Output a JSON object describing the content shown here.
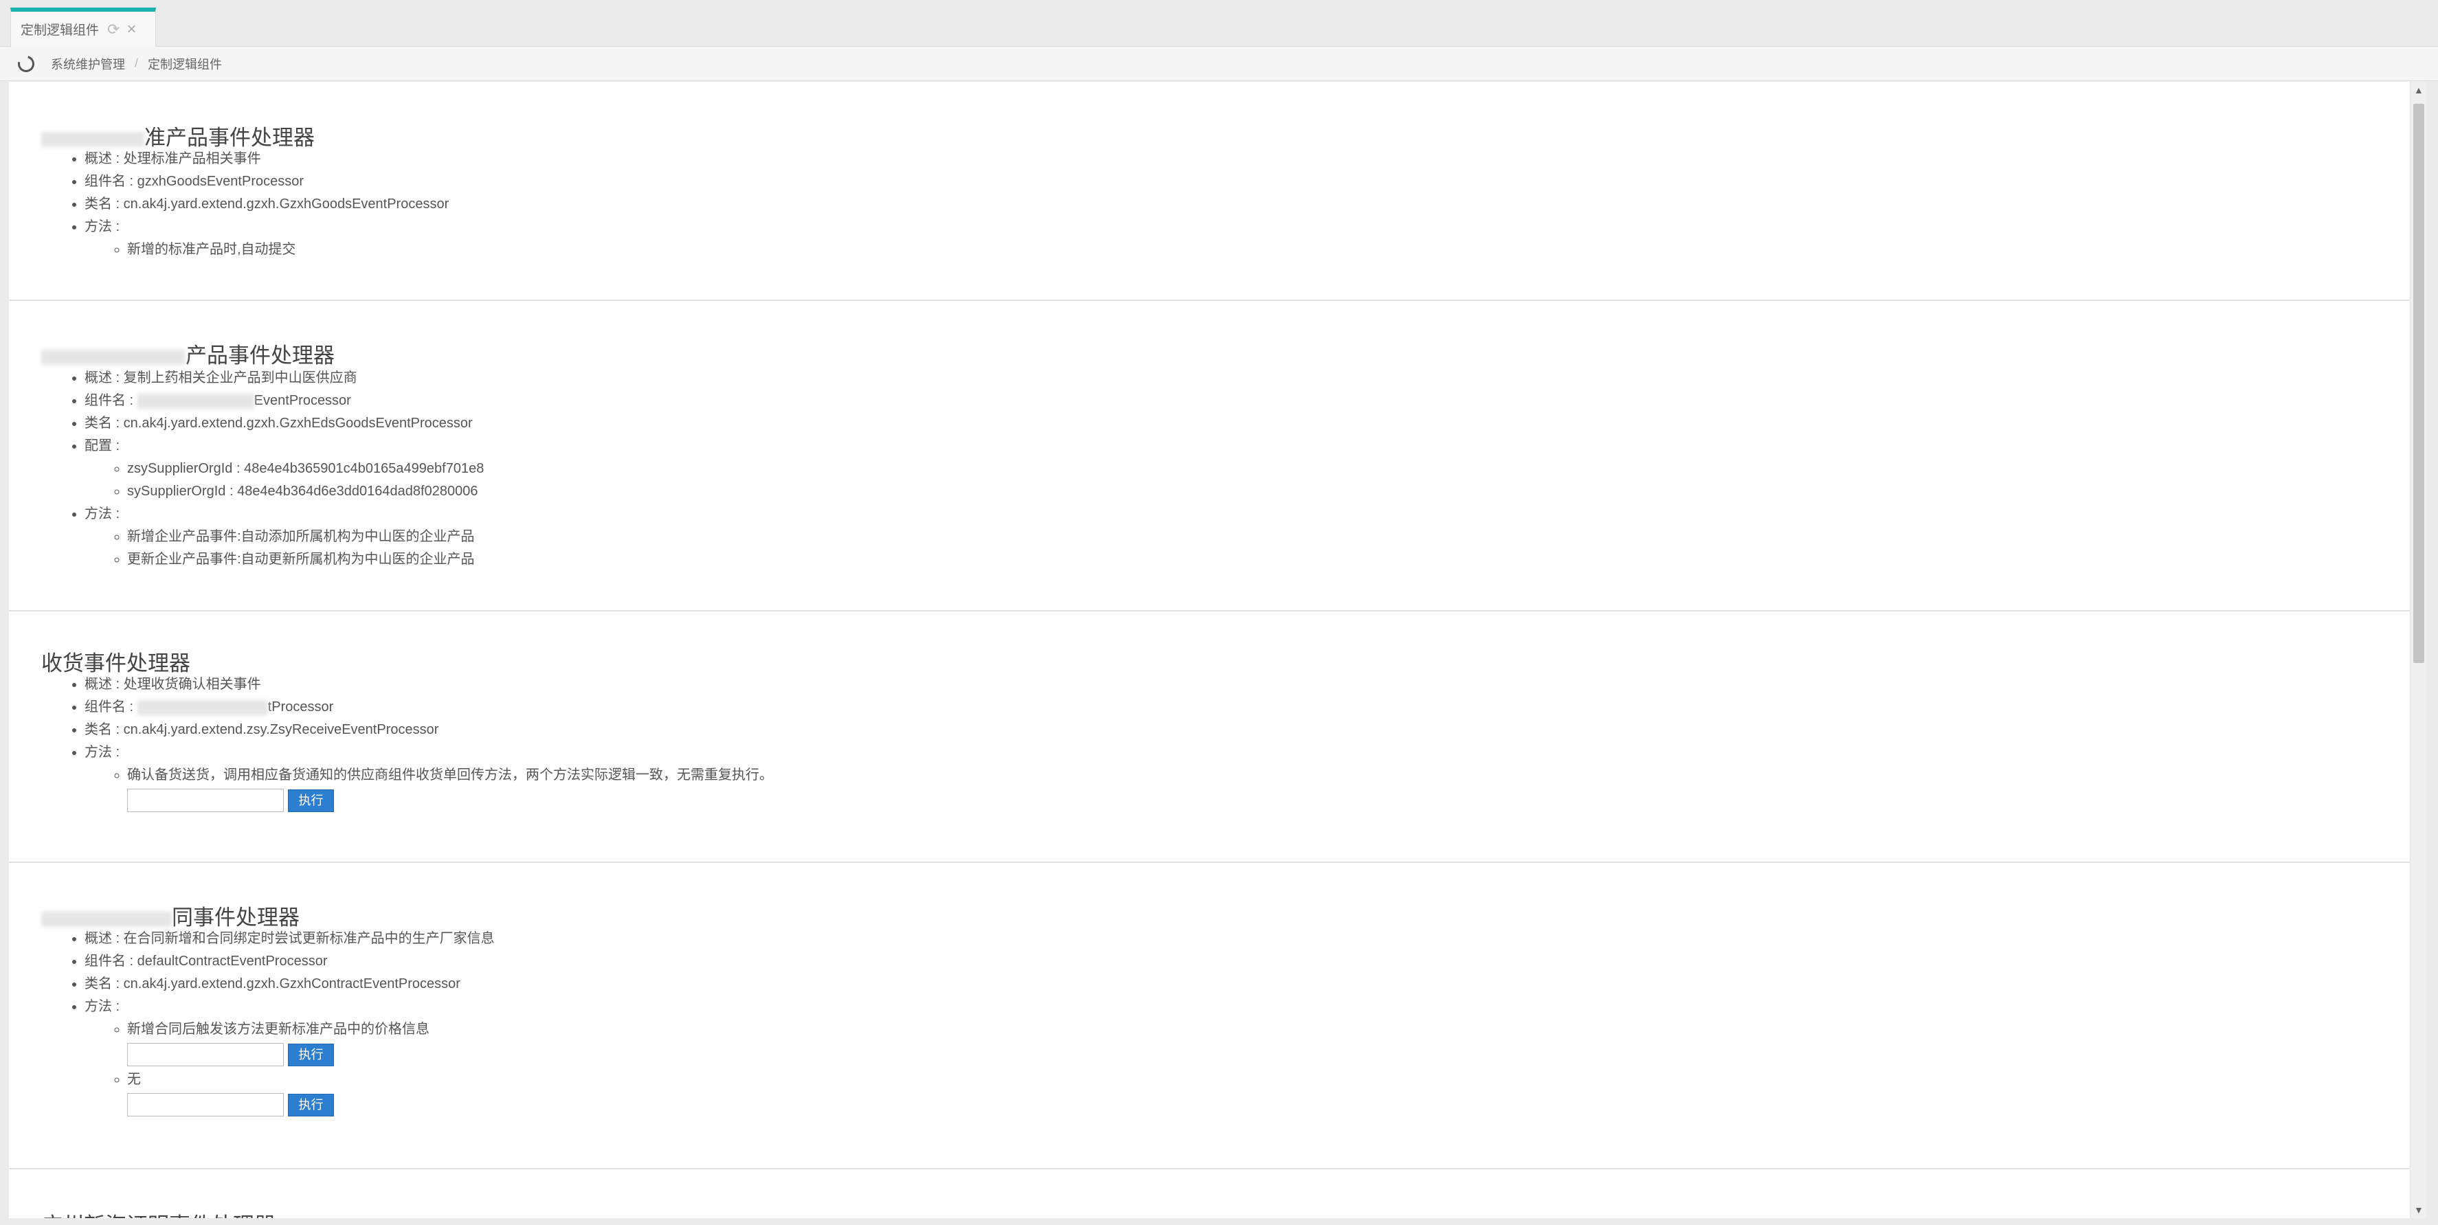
{
  "tab": {
    "label": "定制逻辑组件",
    "refresh_icon": "refresh-icon",
    "close_icon": "close-icon"
  },
  "breadcrumb": {
    "root": "系统维护管理",
    "separator": "/",
    "current": "定制逻辑组件"
  },
  "labels": {
    "overview": "概述 : ",
    "component": "组件名 : ",
    "class": "类名 : ",
    "config": "配置 :",
    "methods": "方法 :",
    "run": "执行"
  },
  "sections": [
    {
      "title_suffix": "准产品事件处理器",
      "overview": "处理标准产品相关事件",
      "component": "gzxhGoodsEventProcessor",
      "class": "cn.ak4j.yard.extend.gzxh.GzxhGoodsEventProcessor",
      "methods": [
        "新增的标准产品时,自动提交"
      ]
    },
    {
      "title_suffix": "产品事件处理器",
      "overview": "复制上药相关企业产品到中山医供应商",
      "component_suffix": "EventProcessor",
      "class": "cn.ak4j.yard.extend.gzxh.GzxhEdsGoodsEventProcessor",
      "config": [
        "zsySupplierOrgId : 48e4e4b365901c4b0165a499ebf701e8",
        "sySupplierOrgId : 48e4e4b364d6e3dd0164dad8f0280006"
      ],
      "methods": [
        "新增企业产品事件:自动添加所属机构为中山医的企业产品",
        "更新企业产品事件:自动更新所属机构为中山医的企业产品"
      ]
    },
    {
      "title": "收货事件处理器",
      "overview": "处理收货确认相关事件",
      "component_suffix": "tProcessor",
      "class": "cn.ak4j.yard.extend.zsy.ZsyReceiveEventProcessor",
      "methods": [
        "确认备货送货，调用相应备货通知的供应商组件收货单回传方法，两个方法实际逻辑一致，无需重复执行。"
      ]
    },
    {
      "title_suffix": "同事件处理器",
      "overview": "在合同新增和合同绑定时尝试更新标准产品中的生产厂家信息",
      "component": "defaultContractEventProcessor",
      "class": "cn.ak4j.yard.extend.gzxh.GzxhContractEventProcessor",
      "methods": [
        "新增合同后触发该方法更新标准产品中的价格信息",
        "无"
      ]
    },
    {
      "title_partial": "广州新海证明事件处理器"
    }
  ]
}
